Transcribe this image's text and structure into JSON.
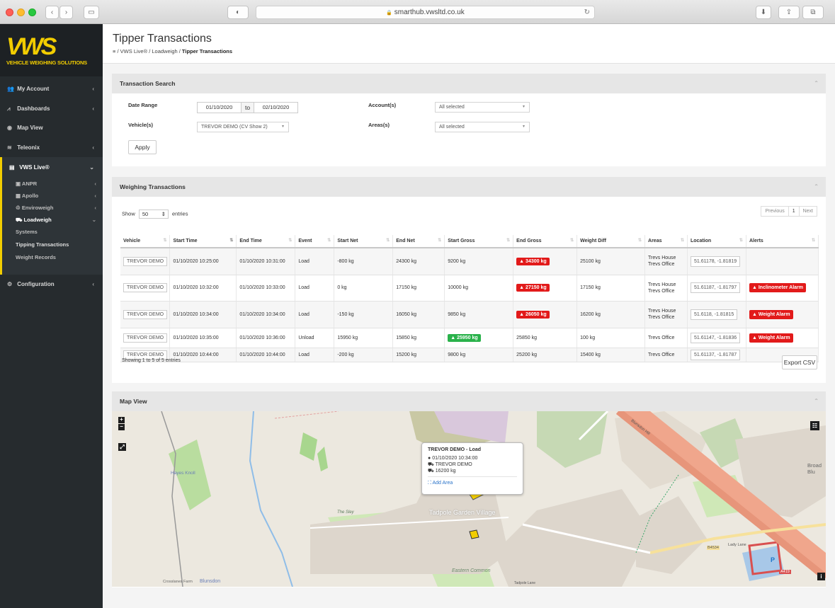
{
  "browser": {
    "url": "smarthub.vwsltd.co.uk",
    "lock": "🔒"
  },
  "logo": {
    "mark": "VWS",
    "subtitle": "VEHICLE WEIGHING SOLUTIONS"
  },
  "sidebar": {
    "items": [
      {
        "label": "My Account"
      },
      {
        "label": "Dashboards"
      },
      {
        "label": "Map View"
      },
      {
        "label": "Teleonix"
      }
    ],
    "open_section": "VWS Live®",
    "sub_items": [
      {
        "label": "ANPR"
      },
      {
        "label": "Apollo"
      },
      {
        "label": "Enviroweigh"
      },
      {
        "label": "Loadweigh"
      }
    ],
    "subsub_items": [
      {
        "label": "Systems"
      },
      {
        "label": "Tipping Transactions"
      },
      {
        "label": "Weight Records"
      }
    ],
    "config": "Configuration"
  },
  "header": {
    "title": "Tipper Transactions",
    "crumb_1": "VWS Live®",
    "crumb_2": "Loadweigh",
    "crumb_3": "Tipper Transactions"
  },
  "search": {
    "title": "Transaction Search",
    "date_range_label": "Date Range",
    "date_from": "01/10/2020",
    "to_label": "to",
    "date_to": "02/10/2020",
    "vehicles_label": "Vehicle(s)",
    "vehicle_value": "TREVOR DEMO (CV Show 2)",
    "accounts_label": "Account(s)",
    "accounts_value": "All selected",
    "areas_label": "Areas(s)",
    "areas_value": "All selected",
    "apply": "Apply"
  },
  "weighing": {
    "title": "Weighing Transactions",
    "show": "Show",
    "page_size": "50",
    "entries": "entries",
    "previous": "Previous",
    "page": "1",
    "next": "Next",
    "columns": [
      "Vehicle",
      "Start Time",
      "End Time",
      "Event",
      "Start Net",
      "End Net",
      "Start Gross",
      "End Gross",
      "Weight Diff",
      "Areas",
      "Location",
      "Alerts"
    ],
    "rows": [
      {
        "vehicle": "TREVOR DEMO",
        "start": "01/10/2020 10:25:00",
        "end": "01/10/2020 10:31:00",
        "event": "Load",
        "start_net": "-800 kg",
        "end_net": "24300 kg",
        "start_gross": "9200 kg",
        "end_gross": "34300 kg",
        "diff": "25100 kg",
        "areas": "Trevs House Trevs Office",
        "location": "51.61178, -1.81819",
        "alert": ""
      },
      {
        "vehicle": "TREVOR DEMO",
        "start": "01/10/2020 10:32:00",
        "end": "01/10/2020 10:33:00",
        "event": "Load",
        "start_net": "0 kg",
        "end_net": "17150 kg",
        "start_gross": "10000 kg",
        "end_gross": "27150 kg",
        "diff": "17150 kg",
        "areas": "Trevs House Trevs Office",
        "location": "51.61187, -1.81797",
        "alert": "Inclinometer Alarm"
      },
      {
        "vehicle": "TREVOR DEMO",
        "start": "01/10/2020 10:34:00",
        "end": "01/10/2020 10:34:00",
        "event": "Load",
        "start_net": "-150 kg",
        "end_net": "16050 kg",
        "start_gross": "9850 kg",
        "end_gross": "26050 kg",
        "diff": "16200 kg",
        "areas": "Trevs House Trevs Office",
        "location": "51.6118, -1.81815",
        "alert": "Weight Alarm"
      },
      {
        "vehicle": "TREVOR DEMO",
        "start": "01/10/2020 10:35:00",
        "end": "01/10/2020 10:36:00",
        "event": "Unload",
        "start_net": "15950 kg",
        "end_net": "15850 kg",
        "start_gross": "25950 kg",
        "end_gross": "25850 kg",
        "diff": "100 kg",
        "areas": "Trevs Office",
        "location": "51.61147, -1.81836",
        "alert": "Weight Alarm"
      },
      {
        "vehicle": "TREVOR DEMO",
        "start": "01/10/2020 10:44:00",
        "end": "01/10/2020 10:44:00",
        "event": "Load",
        "start_net": "-200 kg",
        "end_net": "15200 kg",
        "start_gross": "9800 kg",
        "end_gross": "25200 kg",
        "diff": "15400 kg",
        "areas": "Trevs Office",
        "location": "51.61137, -1.81787",
        "alert": ""
      }
    ],
    "showing": "Showing 1 to 5 of 5 entries",
    "export": "Export CSV"
  },
  "map": {
    "title": "Map View",
    "zoom_in": "+",
    "zoom_out": "−",
    "popup_title": "TREVOR DEMO - Load",
    "popup_time": "01/10/2020 10:34:00",
    "popup_vehicle": "TREVOR DEMO",
    "popup_weight": "16200 kg",
    "popup_add": "Add Area",
    "labels": {
      "hayes": "Hayes Knoll",
      "tadpole": "Tadpole Garden Village",
      "eastern": "Eastern Common",
      "sley": "The Sley",
      "blunsdon": "Blunsdon",
      "crosslanes": "Crosslanes Farm",
      "broad": "Broad Blu",
      "b4534": "B4534",
      "a419": "A419",
      "lady": "Lady Lane",
      "tadpole_lane": "Tadpole Lane",
      "blunsdon_hill": "Blunsdon Hill"
    }
  },
  "colors": {
    "brand_yellow": "#f2cd00",
    "alert_red": "#e21a1a",
    "ok_green": "#2ab24b",
    "sidebar": "#262b2e"
  }
}
